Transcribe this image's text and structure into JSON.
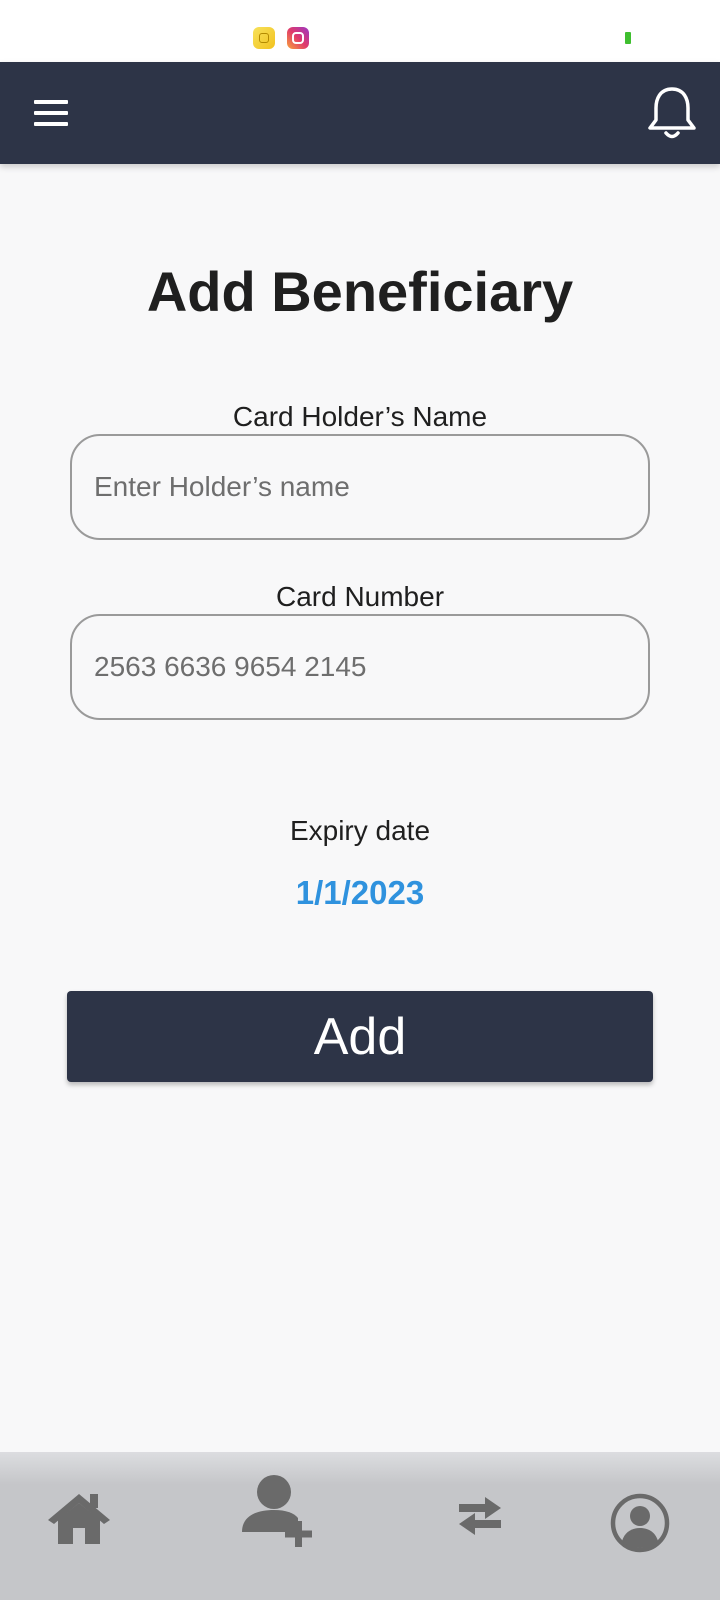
{
  "status_bar": {
    "icons": [
      "app-notification-icon",
      "instagram-icon",
      "battery-icon"
    ]
  },
  "app_bar": {
    "menu_icon": "hamburger-menu-icon",
    "notification_icon": "bell-icon"
  },
  "page": {
    "title": "Add Beneficiary"
  },
  "form": {
    "holder_name": {
      "label": "Card Holder’s Name",
      "placeholder": "Enter Holder’s name",
      "value": ""
    },
    "card_number": {
      "label": "Card Number",
      "placeholder": "2563 6636 9654 2145",
      "value": ""
    },
    "expiry": {
      "label": "Expiry date",
      "value": "1/1/2023"
    },
    "submit_label": "Add"
  },
  "bottom_nav": {
    "items": [
      {
        "icon": "home-icon"
      },
      {
        "icon": "add-user-icon"
      },
      {
        "icon": "transfer-arrows-icon"
      },
      {
        "icon": "profile-icon"
      }
    ]
  },
  "colors": {
    "primary": "#2d3447",
    "accent": "#2f92de",
    "background": "#f8f8f9",
    "nav_background": "#c5c6c9",
    "nav_icon": "#6a6a6a"
  }
}
